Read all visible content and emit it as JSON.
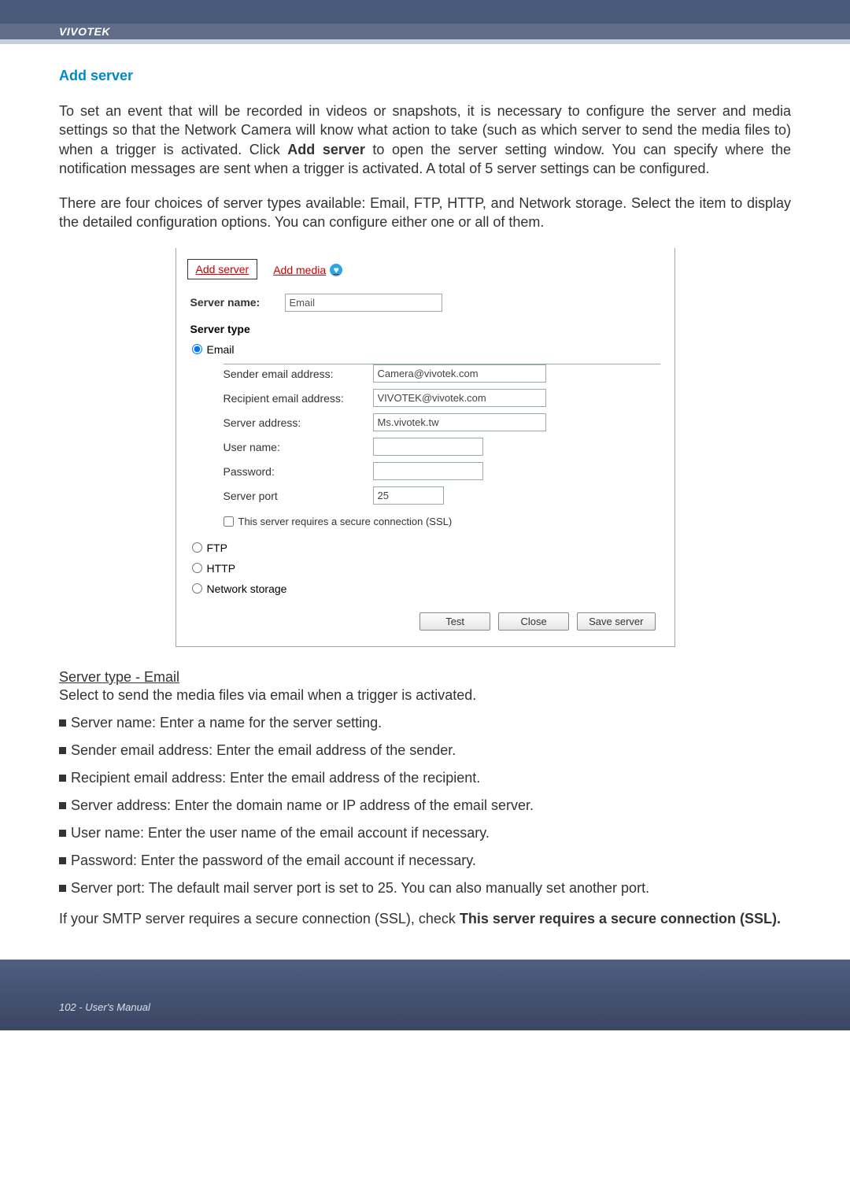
{
  "brand": "VIVOTEK",
  "section_title": "Add server",
  "intro_para_pre": "To set an event that will be recorded in videos or snapshots, it is necessary to configure the server and media settings so that the Network Camera will know what action to take (such as which server to send the media files to) when a trigger is activated. Click ",
  "intro_bold": "Add server",
  "intro_para_post": " to open the server setting window. You can specify where the notification messages are sent when a trigger is activated. A total of 5 server settings can be configured.",
  "para2": "There are four choices of server types available: Email, FTP, HTTP, and Network storage. Select the item to display the detailed configuration options. You can configure either one or all of them.",
  "tabs": {
    "add_server": "Add server",
    "add_media": "Add media"
  },
  "form": {
    "server_name_label": "Server name:",
    "server_name_value": "Email",
    "server_type_label": "Server type",
    "email_radio": "Email",
    "fields": {
      "sender_label": "Sender email address:",
      "sender_value": "Camera@vivotek.com",
      "recipient_label": "Recipient email address:",
      "recipient_value": "VIVOTEK@vivotek.com",
      "server_addr_label": "Server address:",
      "server_addr_value": "Ms.vivotek.tw",
      "user_label": "User name:",
      "user_value": "",
      "pwd_label": "Password:",
      "pwd_value": "",
      "port_label": "Server port",
      "port_value": "25",
      "ssl_label": "This server requires a secure connection (SSL)"
    },
    "ftp_radio": "FTP",
    "http_radio": "HTTP",
    "ns_radio": "Network storage",
    "buttons": {
      "test": "Test",
      "close": "Close",
      "save": "Save server"
    }
  },
  "subhead": "Server type - Email",
  "subhead_desc": "Select to send the media files via email when a trigger is activated.",
  "bullets": [
    "Server name: Enter a name for the server setting.",
    "Sender email address: Enter the email address of the sender.",
    "Recipient email address: Enter the email address of the recipient.",
    "Server address: Enter the domain name or IP address of the email server.",
    "User name: Enter the user name of the email account if necessary.",
    "Password: Enter the password of the email account if necessary.",
    "Server port: The default mail server port is set to 25. You can also manually set another port."
  ],
  "closing_pre": "If your SMTP server requires a secure connection (SSL), check ",
  "closing_bold": "This server requires a secure connection (SSL).",
  "footer": "102 - User's Manual"
}
